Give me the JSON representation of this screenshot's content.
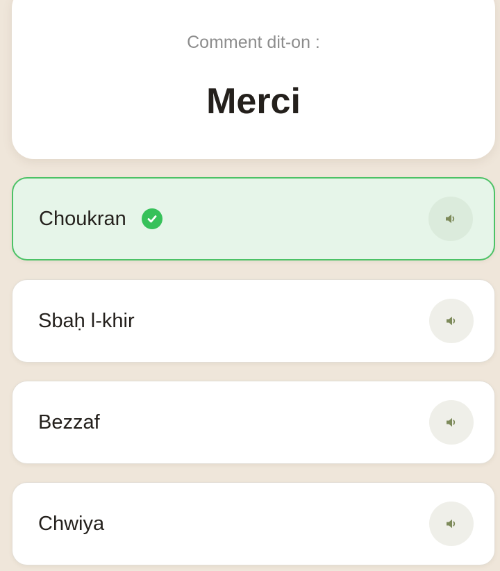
{
  "question": {
    "prompt": "Comment dit-on :",
    "word": "Merci"
  },
  "options": [
    {
      "label": "Choukran",
      "state": "correct"
    },
    {
      "label": "Sbaḥ l-khir",
      "state": "default"
    },
    {
      "label": "Bezzaf",
      "state": "default"
    },
    {
      "label": "Chwiya",
      "state": "default"
    }
  ],
  "colors": {
    "background": "#efe6da",
    "correct_fill": "#e6f5e9",
    "correct_border": "#4cc266",
    "check": "#37c15a",
    "speaker_icon": "#7d8a5a"
  },
  "icons": {
    "check": "check-circle-icon",
    "audio": "speaker-icon"
  }
}
